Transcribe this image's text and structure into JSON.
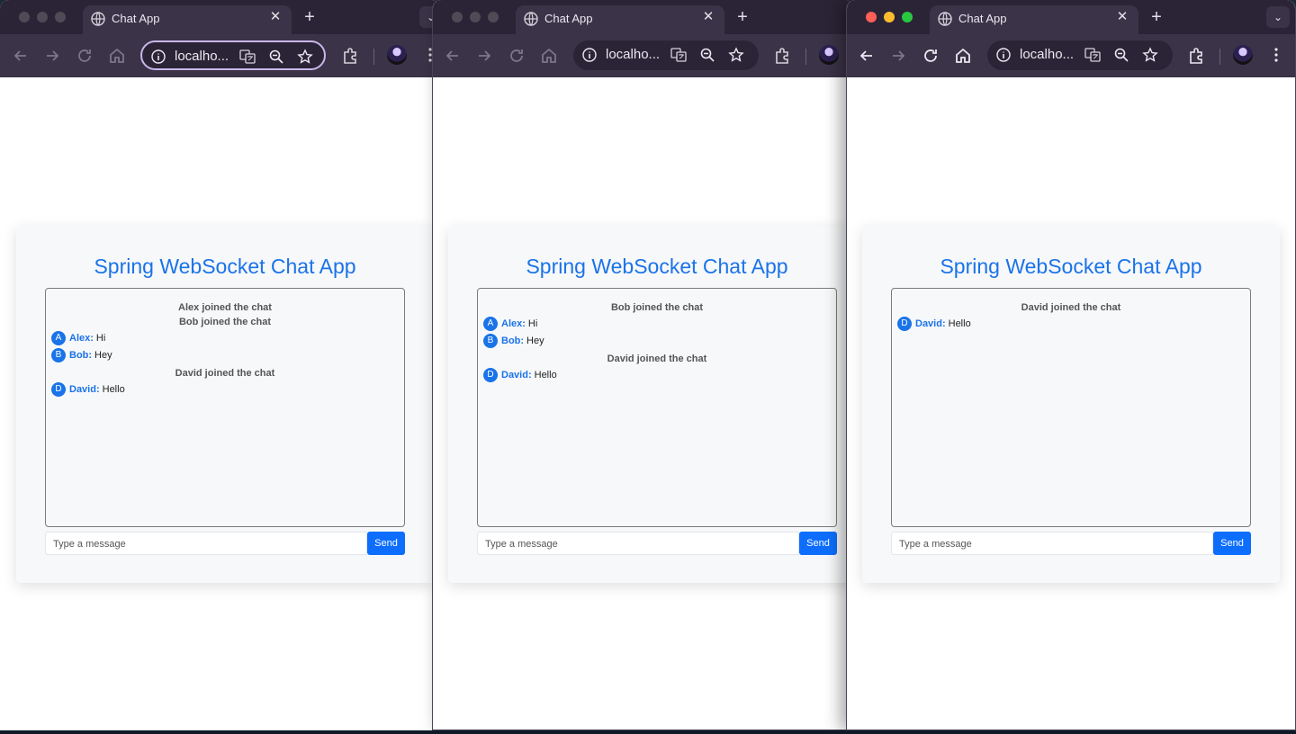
{
  "colors": {
    "accent": "#1a73e8",
    "send_button": "#0d6efd",
    "chrome_tabbar": "#2b2436",
    "chrome_toolbar": "#3b3347"
  },
  "windows": [
    {
      "tab_title": "Chat App",
      "url": "localho...",
      "app_title": "Spring WebSocket Chat App",
      "messages": [
        {
          "type": "system",
          "text": "Alex joined the chat"
        },
        {
          "type": "system",
          "text": "Bob joined the chat"
        },
        {
          "type": "chat",
          "avatar": "A",
          "name": "Alex:",
          "text": "Hi"
        },
        {
          "type": "chat",
          "avatar": "B",
          "name": "Bob:",
          "text": "Hey"
        },
        {
          "type": "system",
          "text": "David joined the chat"
        },
        {
          "type": "chat",
          "avatar": "D",
          "name": "David:",
          "text": "Hello"
        }
      ],
      "input_placeholder": "Type a message",
      "send_label": "Send"
    },
    {
      "tab_title": "Chat App",
      "url": "localho...",
      "app_title": "Spring WebSocket Chat App",
      "messages": [
        {
          "type": "system",
          "text": "Bob joined the chat"
        },
        {
          "type": "chat",
          "avatar": "A",
          "name": "Alex:",
          "text": "Hi"
        },
        {
          "type": "chat",
          "avatar": "B",
          "name": "Bob:",
          "text": "Hey"
        },
        {
          "type": "system",
          "text": "David joined the chat"
        },
        {
          "type": "chat",
          "avatar": "D",
          "name": "David:",
          "text": "Hello"
        }
      ],
      "input_placeholder": "Type a message",
      "send_label": "Send"
    },
    {
      "tab_title": "Chat App",
      "url": "localho...",
      "app_title": "Spring WebSocket Chat App",
      "messages": [
        {
          "type": "system",
          "text": "David joined the chat"
        },
        {
          "type": "chat",
          "avatar": "D",
          "name": "David:",
          "text": "Hello"
        }
      ],
      "input_placeholder": "Type a message",
      "send_label": "Send"
    }
  ]
}
